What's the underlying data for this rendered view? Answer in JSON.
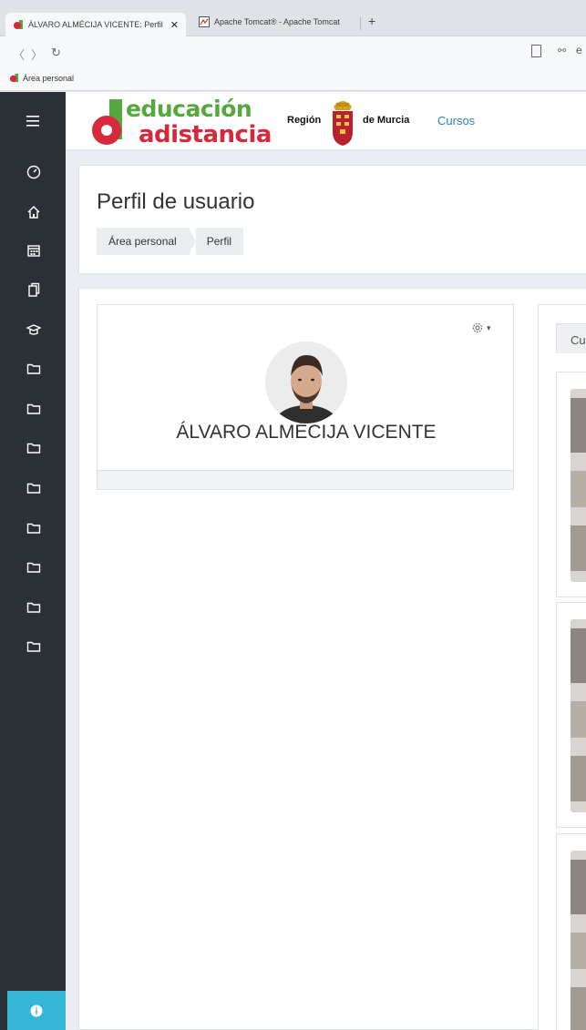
{
  "browser": {
    "active_tab_title": "ÁLVARO ALMÉCIJA VICENTE: Perfil",
    "inactive_tab_title": "Apache Tomcat® - Apache Tomcat",
    "close_glyph": "✕",
    "new_tab_glyph": "+",
    "back_glyph": "〈",
    "forward_glyph": "〉",
    "reload_glyph": "↻",
    "site_info_glyph": "⚯",
    "url_fragment": "e",
    "bookmark_label": "Área personal"
  },
  "header": {
    "logo_line1": "educación",
    "logo_line2": "adistancia",
    "region": "Región",
    "de_murcia": "de Murcia",
    "cursos_link": "Cursos"
  },
  "page": {
    "title": "Perfil de usuario",
    "breadcrumb": [
      "Área personal",
      "Perfil"
    ]
  },
  "profile": {
    "name": "ÁLVARO ALMÉCIJA VICENTE",
    "menu_caret": "▾"
  },
  "courses": {
    "tab_label": "Cu"
  },
  "colors": {
    "drawer_bg": "#2b3036",
    "accent": "#2a7fc1",
    "logo_green": "#55a83d",
    "logo_red": "#d8283c",
    "help_button": "#35b6d6"
  },
  "drawer": {
    "icons": [
      "dashboard-icon",
      "home-icon",
      "calendar-icon",
      "files-icon",
      "graduation-cap-icon",
      "folder-icon",
      "folder-icon",
      "folder-icon",
      "folder-icon",
      "folder-icon",
      "folder-icon",
      "folder-icon",
      "folder-icon"
    ],
    "help_icon": "info-icon"
  }
}
